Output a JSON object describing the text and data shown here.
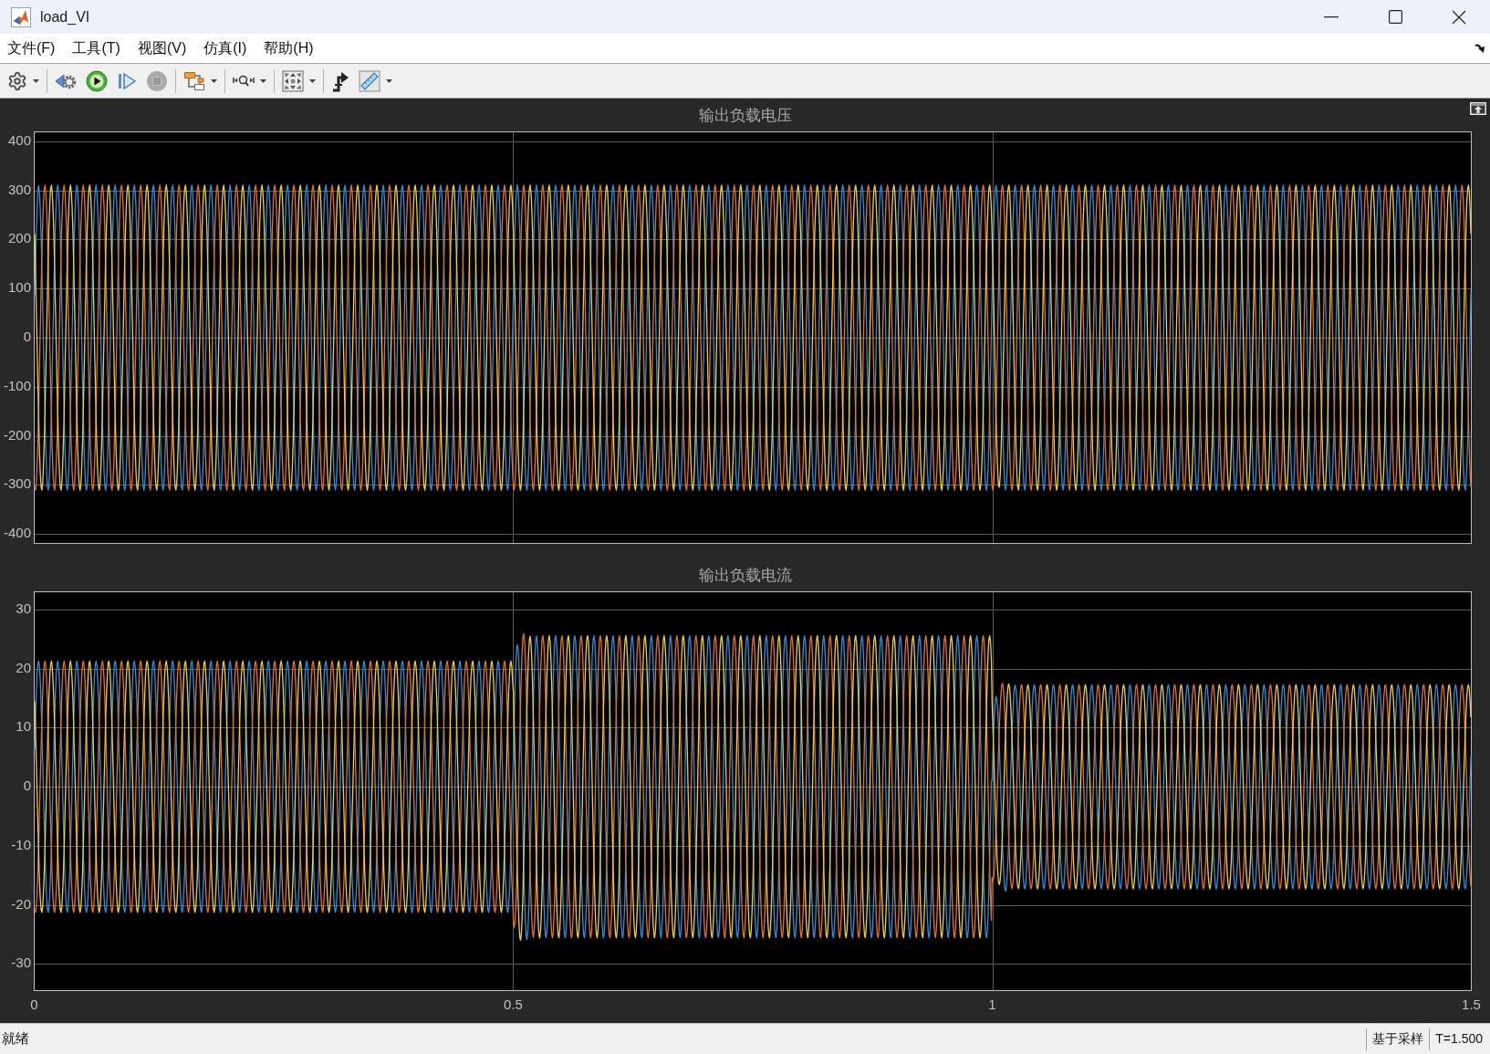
{
  "window": {
    "title": "load_VI"
  },
  "menu": [
    "文件(F)",
    "工具(T)",
    "视图(V)",
    "仿真(I)",
    "帮助(H)"
  ],
  "toolbar": {
    "groups": [
      {
        "buttons": [
          {
            "kind": "settings",
            "dropdown": true,
            "disabled": false
          }
        ]
      },
      {
        "buttons": [
          {
            "kind": "step_back",
            "dropdown": false,
            "disabled": false
          },
          {
            "kind": "run",
            "dropdown": false,
            "disabled": false
          },
          {
            "kind": "step_forward",
            "dropdown": false,
            "disabled": false
          },
          {
            "kind": "stop",
            "dropdown": false,
            "disabled": true
          }
        ]
      },
      {
        "buttons": [
          {
            "kind": "signals",
            "dropdown": true,
            "disabled": false
          }
        ]
      },
      {
        "buttons": [
          {
            "kind": "zoom",
            "dropdown": true,
            "disabled": false
          }
        ]
      },
      {
        "buttons": [
          {
            "kind": "fit",
            "dropdown": true,
            "disabled": false
          }
        ]
      },
      {
        "buttons": [
          {
            "kind": "trigger",
            "dropdown": false,
            "disabled": false
          },
          {
            "kind": "measure",
            "dropdown": true,
            "disabled": false
          }
        ]
      }
    ]
  },
  "plots": [
    {
      "kind": "voltage",
      "title": "输出负载电压",
      "yticks": [
        "400",
        "300",
        "200",
        "100",
        "0",
        "-100",
        "-200",
        "-300",
        "-400"
      ]
    },
    {
      "kind": "current",
      "title": "输出负载电流",
      "yticks": [
        "30",
        "20",
        "10",
        "0",
        "-10",
        "-20",
        "-30"
      ]
    }
  ],
  "x_axis": {
    "ticks": [
      "0",
      "0.5",
      "1",
      "1.5"
    ]
  },
  "status_bar": {
    "status": "就绪",
    "mode": "基于采样",
    "time": "T=1.500"
  }
}
